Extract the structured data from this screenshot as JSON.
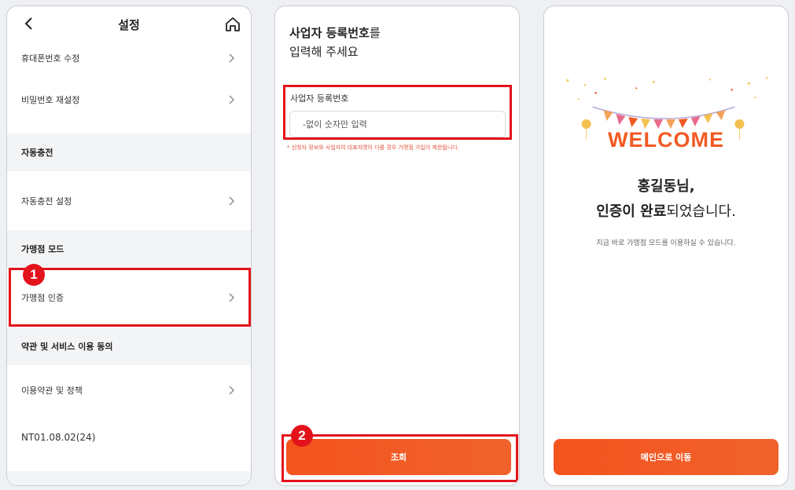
{
  "colors": {
    "accent": "#f4531e",
    "highlight": "#e3131b",
    "section_bg": "#f3f4f6"
  },
  "screen1": {
    "title": "설정",
    "back_icon": "chevron-left-icon",
    "home_icon": "home-icon",
    "rows_top": [
      {
        "label": "휴대폰번호 수정"
      },
      {
        "label": "비밀번호 재설정"
      }
    ],
    "sections": {
      "auto_charge": "자동충전",
      "merchant_mode": "가맹점 모드",
      "terms": "약관 및 서비스 이용 동의"
    },
    "auto_charge_row": "자동충전 설정",
    "merchant_row": "가맹점 인증",
    "terms_row": "이용약관 및 정책",
    "version": "NT01.08.02(24)",
    "step_badge": "1"
  },
  "screen2": {
    "heading_bold": "사업자 등록번호",
    "heading_rest": "를",
    "heading_line2": "입력해 주세요",
    "field_label": "사업자 등록번호",
    "field_placeholder": "-없이 숫자만 입력",
    "notice": "* 신청자 정보와 사업자의 대표자명이 다를 경우 가맹점 가입이 제한됩니다.",
    "submit_label": "조회",
    "step_badge": "2"
  },
  "screen3": {
    "welcome": "WELCOME",
    "name_line": "홍길동님,",
    "done_bold": "인증이 완료",
    "done_rest": "되었습니다.",
    "sub": "지금 바로 가맹점 모드를 이용하실 수 있습니다.",
    "main_button": "메인으로 이동"
  }
}
